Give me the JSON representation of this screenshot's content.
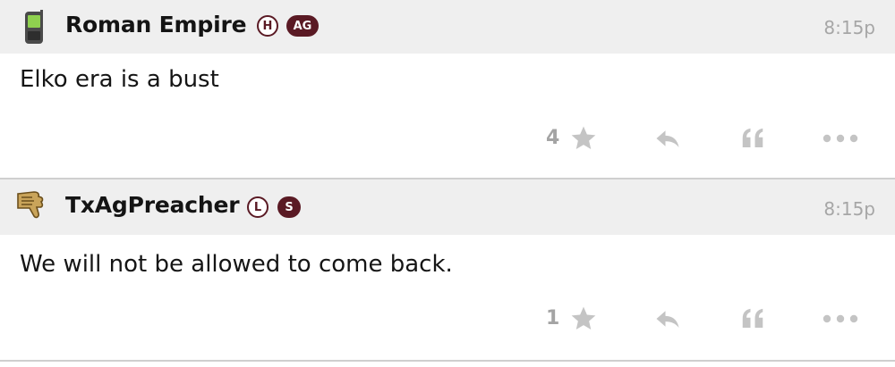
{
  "posts": [
    {
      "username": "Roman Empire",
      "badges": [
        "H",
        "AG"
      ],
      "timestamp": "8:15p",
      "message": "Elko era is a bust",
      "stars": "4",
      "avatar_icon": "phone-icon"
    },
    {
      "username": "TxAgPreacher",
      "badges": [
        "L",
        "S"
      ],
      "timestamp": "8:15p",
      "message": "We will not be allowed to come back.",
      "stars": "1",
      "avatar_icon": "thumbs-down-icon"
    }
  ],
  "colors": {
    "badge_maroon": "#5a1a24",
    "header_bg": "#efefef",
    "icon_gray": "#b8b8b8"
  }
}
